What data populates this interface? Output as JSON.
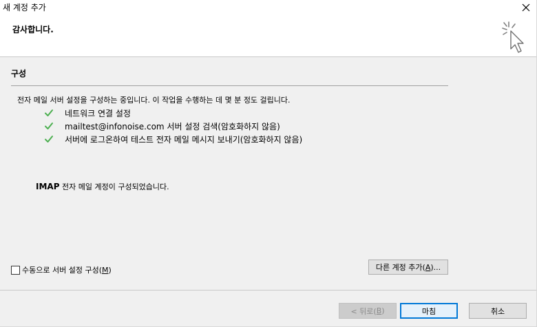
{
  "window": {
    "title": "새 계정 추가"
  },
  "header": {
    "title": "감사합니다."
  },
  "section": {
    "title": "구성",
    "intro": "전자 메일 서버 설정을 구성하는 중입니다. 이 작업을 수행하는 데 몇 분 정도 걸립니다.",
    "steps": [
      "네트워크 연결 설정",
      "mailtest@infonoise.com 서버 설정 검색(암호화하지 않음)",
      "서버에 로그온하여 테스트 전자 메일 메시지 보내기(암호화하지 않음)"
    ],
    "result_bold": "IMAP",
    "result_rest": " 전자 메일 계정이 구성되었습니다."
  },
  "options": {
    "manual_config_label": "수동으로 서버 설정 구성(",
    "manual_config_key": "M",
    "manual_config_checked": false
  },
  "buttons": {
    "add_account_label": "다른 계정 추가(",
    "add_account_key": "A",
    "add_account_suffix": ")...",
    "back_label": "< 뒤로(",
    "back_key": "B",
    "finish_label": "마침",
    "cancel_label": "취소"
  },
  "colors": {
    "check_green": "#4caf50",
    "focus_blue": "#0078d7"
  }
}
